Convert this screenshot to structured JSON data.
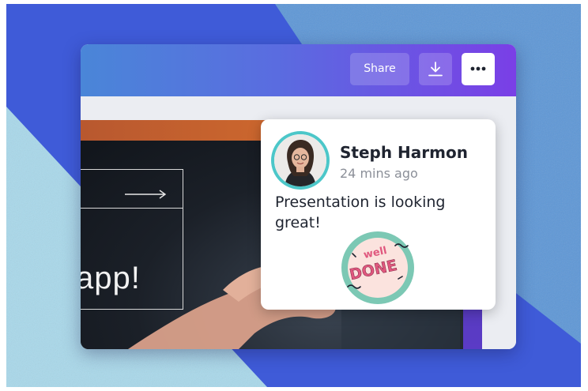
{
  "colors": {
    "background_blue": "#3f5bd8",
    "paper_light": "#a9d8ea",
    "paper_mid": "#5e97d6",
    "topbar_start": "#4a86d8",
    "topbar_end": "#7a3fe6",
    "accent_pink": "#e0577e",
    "sticker_teal": "#7cc8b4"
  },
  "toolbar": {
    "share_label": "Share",
    "download_icon": "download-icon",
    "more_icon": "more-horizontal-icon"
  },
  "slide": {
    "headline_fragment": "app!",
    "arrow_icon": "arrow-right-icon"
  },
  "comment": {
    "author": "Steph Harmon",
    "time_ago": "24 mins ago",
    "message": "Presentation is looking great!",
    "sticker": {
      "line1": "well",
      "line2": "DONE"
    }
  }
}
